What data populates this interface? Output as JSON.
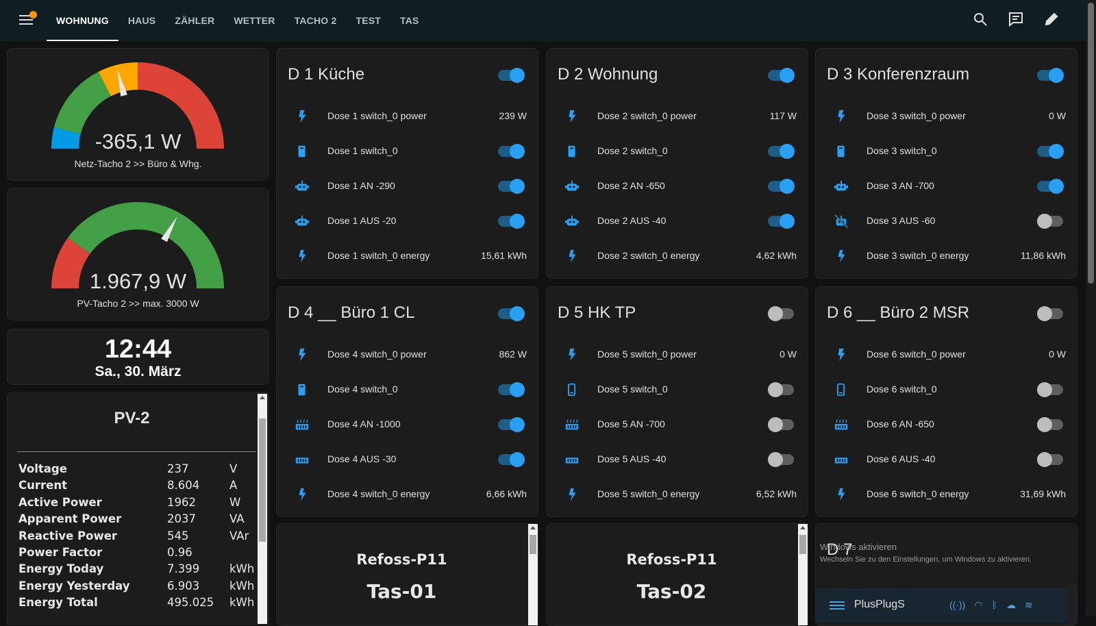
{
  "tabs": [
    "WOHNUNG",
    "HAUS",
    "ZÄHLER",
    "WETTER",
    "TACHO 2",
    "TEST",
    "TAS"
  ],
  "gauges": [
    {
      "value": "-365,1 W",
      "label": "Netz-Tacho 2 >> Büro & Whg.",
      "needle_fraction": 0.42
    },
    {
      "value": "1.967,9 W",
      "label": "PV-Tacho 2 >> max. 3000 W",
      "needle_fraction": 0.66
    }
  ],
  "clock": {
    "time": "12:44",
    "date": "Sa., 30. März"
  },
  "pv2": {
    "title": "PV-2",
    "rows": [
      {
        "k": "Voltage",
        "v": "237",
        "u": "V"
      },
      {
        "k": "Current",
        "v": "8.604",
        "u": "A"
      },
      {
        "k": "Active Power",
        "v": "1962",
        "u": "W"
      },
      {
        "k": "Apparent Power",
        "v": "2037",
        "u": "VA"
      },
      {
        "k": "Reactive Power",
        "v": "545",
        "u": "VAr"
      },
      {
        "k": "Power Factor",
        "v": "0.96",
        "u": ""
      },
      {
        "k": "Energy Today",
        "v": "7.399",
        "u": "kWh"
      },
      {
        "k": "Energy Yesterday",
        "v": "6.903",
        "u": "kWh"
      },
      {
        "k": "Energy Total",
        "v": "495.025",
        "u": "kWh"
      }
    ]
  },
  "devices": [
    {
      "title": "D 1 Küche",
      "on": true,
      "rows": [
        {
          "icon": "flash-icon",
          "label": "Dose 1 switch_0 power",
          "value": "239 W"
        },
        {
          "icon": "plug-icon",
          "label": "Dose 1 switch_0",
          "toggle": true
        },
        {
          "icon": "robot-icon",
          "label": "Dose 1 AN -290",
          "toggle": true
        },
        {
          "icon": "robot-icon",
          "label": "Dose 1 AUS -20",
          "toggle": true
        },
        {
          "icon": "lightning-icon",
          "label": "Dose 1 switch_0 energy",
          "value": "15,61 kWh"
        }
      ]
    },
    {
      "title": "D 2 Wohnung",
      "on": true,
      "rows": [
        {
          "icon": "flash-icon",
          "label": "Dose 2 switch_0 power",
          "value": "117 W"
        },
        {
          "icon": "plug-icon",
          "label": "Dose 2 switch_0",
          "toggle": true
        },
        {
          "icon": "robot-icon",
          "label": "Dose 2 AN -650",
          "toggle": true
        },
        {
          "icon": "robot-icon",
          "label": "Dose 2 AUS -40",
          "toggle": true
        },
        {
          "icon": "lightning-icon",
          "label": "Dose 2 switch_0 energy",
          "value": "4,62 kWh"
        }
      ]
    },
    {
      "title": "D 3 Konferenzraum",
      "on": true,
      "rows": [
        {
          "icon": "flash-icon",
          "label": "Dose 3 switch_0 power",
          "value": "0 W"
        },
        {
          "icon": "plug-icon",
          "label": "Dose 3 switch_0",
          "toggle": true
        },
        {
          "icon": "robot-icon",
          "label": "Dose 3 AN -700",
          "toggle": true
        },
        {
          "icon": "robot-off-icon",
          "label": "Dose 3 AUS -60",
          "toggle": false
        },
        {
          "icon": "lightning-icon",
          "label": "Dose 3 switch_0 energy",
          "value": "11,86 kWh"
        }
      ]
    },
    {
      "title": "D 4 __ Büro 1 CL",
      "on": true,
      "rows": [
        {
          "icon": "flash-icon",
          "label": "Dose 4 switch_0 power",
          "value": "862 W"
        },
        {
          "icon": "plug-icon",
          "label": "Dose 4 switch_0",
          "toggle": true
        },
        {
          "icon": "heater-icon",
          "label": "Dose 4 AN -1000",
          "toggle": true
        },
        {
          "icon": "radiator-icon",
          "label": "Dose 4 AUS -30",
          "toggle": true
        },
        {
          "icon": "lightning-icon",
          "label": "Dose 4 switch_0 energy",
          "value": "6,66 kWh"
        }
      ]
    },
    {
      "title": "D 5 HK TP",
      "on": false,
      "rows": [
        {
          "icon": "flash-icon",
          "label": "Dose 5 switch_0 power",
          "value": "0 W"
        },
        {
          "icon": "plug-outline-icon",
          "label": "Dose 5 switch_0",
          "toggle": false
        },
        {
          "icon": "heater-icon",
          "label": "Dose 5 AN -700",
          "toggle": false
        },
        {
          "icon": "radiator-icon",
          "label": "Dose 5 AUS -40",
          "toggle": false
        },
        {
          "icon": "lightning-icon",
          "label": "Dose 5 switch_0 energy",
          "value": "6,52 kWh"
        }
      ]
    },
    {
      "title": "D 6 __ Büro 2 MSR",
      "on": false,
      "rows": [
        {
          "icon": "flash-icon",
          "label": "Dose 6 switch_0 power",
          "value": "0 W"
        },
        {
          "icon": "plug-outline-icon",
          "label": "Dose 6 switch_0",
          "toggle": false
        },
        {
          "icon": "heater-icon",
          "label": "Dose 6 AN -650",
          "toggle": false
        },
        {
          "icon": "radiator-icon",
          "label": "Dose 6 AUS -40",
          "toggle": false
        },
        {
          "icon": "lightning-icon",
          "label": "Dose 6 switch_0 energy",
          "value": "31,69 kWh"
        }
      ]
    }
  ],
  "tas_cards": [
    {
      "line1": "Refoss-P11",
      "line2": "Tas-01"
    },
    {
      "line1": "Refoss-P11",
      "line2": "Tas-02"
    }
  ],
  "d7": {
    "title": "D 7",
    "notice1": "Windows aktivieren",
    "notice2": "Wechseln Sie zu den Einstellungen, um Windows zu aktivieren.",
    "plug_title": "PlusPlugS"
  },
  "colors": {
    "accent": "#2aa0f4",
    "gauge_green": "#43a047",
    "gauge_red": "#db4437",
    "gauge_orange": "#ffa600",
    "gauge_blue": "#039be5"
  }
}
